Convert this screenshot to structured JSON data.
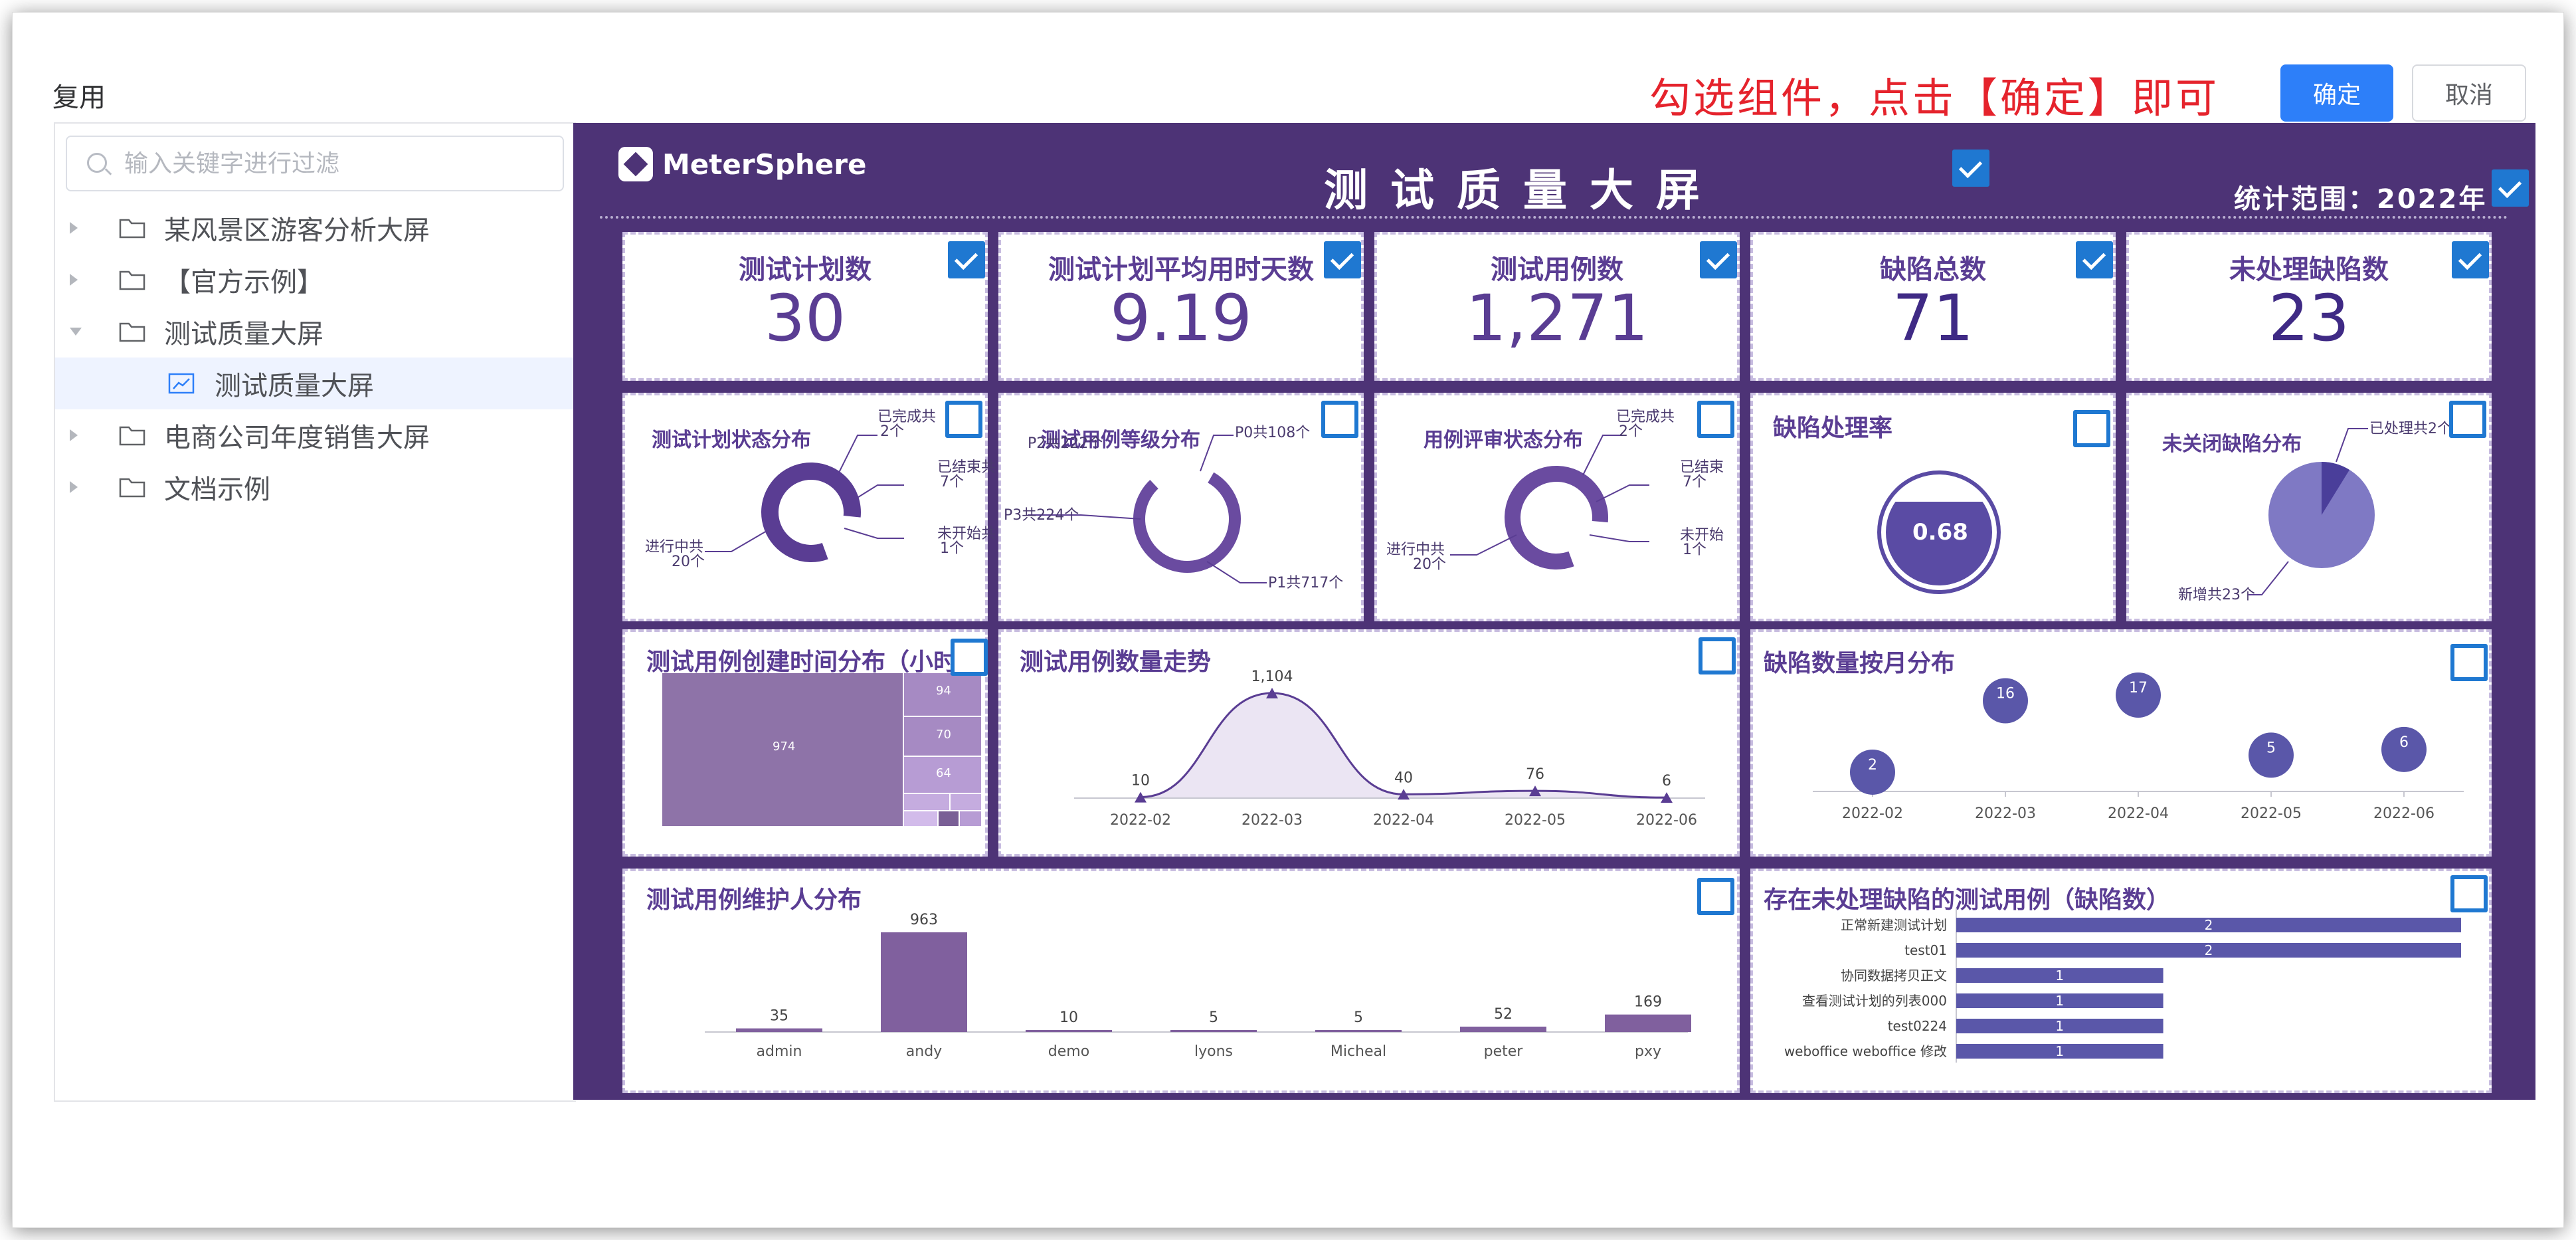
{
  "dialog": {
    "title": "复用",
    "hint": "勾选组件，点击【确定】即可",
    "ok_label": "确定",
    "cancel_label": "取消"
  },
  "search": {
    "placeholder": "输入关键字进行过滤"
  },
  "tree": [
    {
      "label": "某风景区游客分析大屏",
      "type": "folder",
      "expanded": false
    },
    {
      "label": "【官方示例】",
      "type": "folder",
      "expanded": false
    },
    {
      "label": "测试质量大屏",
      "type": "folder",
      "expanded": true
    },
    {
      "label": "测试质量大屏",
      "type": "chart",
      "selected": true
    },
    {
      "label": "电商公司年度销售大屏",
      "type": "folder",
      "expanded": false
    },
    {
      "label": "文档示例",
      "type": "folder",
      "expanded": false
    }
  ],
  "screen": {
    "logo": "MeterSphere",
    "title": "测试质量大屏",
    "scope": "统计范围：2022年"
  },
  "kpis": [
    {
      "title": "测试计划数",
      "value": "30"
    },
    {
      "title": "测试计划平均用时天数",
      "value": "9.19"
    },
    {
      "title": "测试用例数",
      "value": "1,271"
    },
    {
      "title": "缺陷总数",
      "value": "71"
    },
    {
      "title": "未处理缺陷数",
      "value": "23"
    }
  ],
  "donuts": [
    {
      "title": "测试计划状态分布",
      "labels": [
        "已完成共",
        "2个",
        "已结束共",
        "7个",
        "未开始共",
        "1个",
        "进行中共",
        "20个"
      ]
    },
    {
      "title": "测试用例等级分布",
      "labels": [
        "P0共108个",
        "P1共717个",
        "P3共224个",
        "P2共222个"
      ]
    },
    {
      "title": "用例评审状态分布",
      "labels": [
        "已完成共",
        "2个",
        "已结束",
        "7个",
        "未开始",
        "1个",
        "进行中共",
        "20个"
      ]
    }
  ],
  "defect_rate": {
    "title": "缺陷处理率",
    "value": "0.68"
  },
  "pie": {
    "title": "未关闭缺陷分布",
    "labels": [
      "已处理共2个",
      "新增共23个"
    ]
  },
  "treemap": {
    "title": "测试用例创建时间分布（小时）",
    "labels": [
      "974",
      "94",
      "70",
      "64"
    ]
  },
  "chart_data": [
    {
      "type": "area",
      "title": "测试用例数量走势",
      "categories": [
        "2022-02",
        "2022-03",
        "2022-04",
        "2022-05",
        "2022-06"
      ],
      "values": [
        10,
        1104,
        40,
        76,
        6
      ],
      "labels": [
        "10",
        "1,104",
        "40",
        "76",
        "6"
      ]
    },
    {
      "type": "scatter",
      "title": "缺陷数量按月分布",
      "categories": [
        "2022-02",
        "2022-03",
        "2022-04",
        "2022-05",
        "2022-06"
      ],
      "values": [
        2,
        16,
        17,
        5,
        6
      ]
    },
    {
      "type": "bar",
      "title": "测试用例维护人分布",
      "categories": [
        "admin",
        "andy",
        "demo",
        "lyons",
        "Micheal",
        "peter",
        "pxy"
      ],
      "values": [
        35,
        963,
        10,
        5,
        5,
        52,
        169
      ]
    },
    {
      "type": "bar",
      "orientation": "horizontal",
      "title": "存在未处理缺陷的测试用例（缺陷数）",
      "categories": [
        "正常新建测试计划",
        "test01",
        "协同数据拷贝正文",
        "查看测试计划的列表000",
        "test0224",
        "weboffice weboffice 修改"
      ],
      "values": [
        2,
        2,
        1,
        1,
        1,
        1
      ]
    }
  ],
  "colors": {
    "screen_bg": "#4d3376",
    "accent": "#5a3d93",
    "primary": "#2d7ff9",
    "hint": "#e5232c",
    "check": "#1f78d1"
  }
}
